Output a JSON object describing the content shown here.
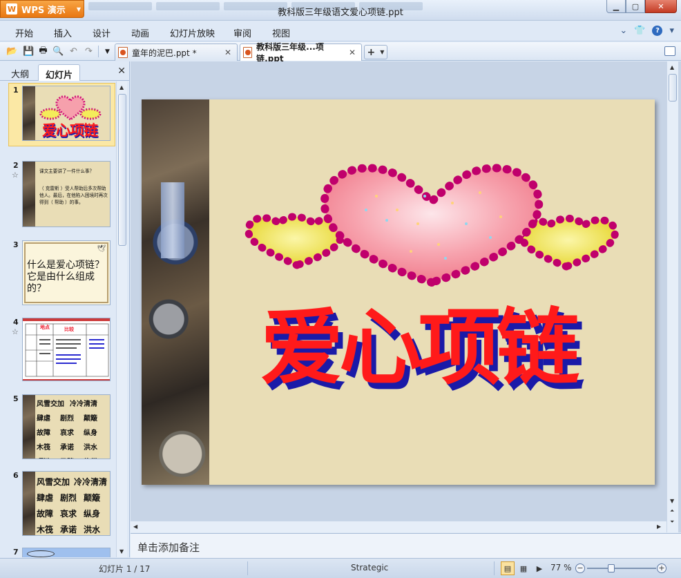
{
  "app": {
    "brand": "WPS 演示",
    "window_title": "教科版三年级语文爱心项链.ppt"
  },
  "menu": [
    "开始",
    "插入",
    "设计",
    "动画",
    "幻灯片放映",
    "审阅",
    "视图"
  ],
  "doc_tabs": [
    {
      "label": "童年的泥巴.ppt *",
      "active": false
    },
    {
      "label": "教科版三年级...项链.ppt",
      "active": true
    }
  ],
  "left_panel": {
    "tabs": [
      "大纲",
      "幻灯片"
    ],
    "active_tab": "幻灯片",
    "thumbnails": [
      {
        "num": "1",
        "title": "爱心项链"
      },
      {
        "num": "2",
        "lines": [
          "课文主要讲了一件什么事？",
          "（ 克雷斯 ）受人帮助后多次帮助他人。最后，在他陷入困境时再次得到（ 帮助 ）的事。"
        ]
      },
      {
        "num": "3",
        "lines": [
          "什么是爱心项链？",
          "它是由什么组成的？"
        ]
      },
      {
        "num": "4",
        "lines": [
          "地点",
          "比较"
        ]
      },
      {
        "num": "5",
        "lines": [
          "风雪交加",
          "冷冷清清",
          "肆虐",
          "剧烈",
          "颠簸",
          "故障",
          "哀求",
          "纵身",
          "木筏",
          "承诺",
          "洪水",
          "项链",
          "马蹄",
          "修缮"
        ]
      },
      {
        "num": "6",
        "lines": [
          "风雪交加",
          "冷冷清清",
          "肆虐",
          "剧烈",
          "颠簸",
          "故障",
          "哀求",
          "纵身",
          "木筏",
          "承诺",
          "洪水"
        ]
      },
      {
        "num": "7"
      }
    ]
  },
  "slide": {
    "title": "爱心项链"
  },
  "notes": {
    "placeholder": "单击添加备注"
  },
  "status": {
    "slide_info": "幻灯片 1 / 17",
    "theme": "Strategic",
    "zoom": "77 %"
  },
  "colors": {
    "accent": "#e87712",
    "title_red": "#ff1a1a",
    "title_shadow": "#1a1aa8",
    "slide_bg": "#e9ddb6"
  }
}
